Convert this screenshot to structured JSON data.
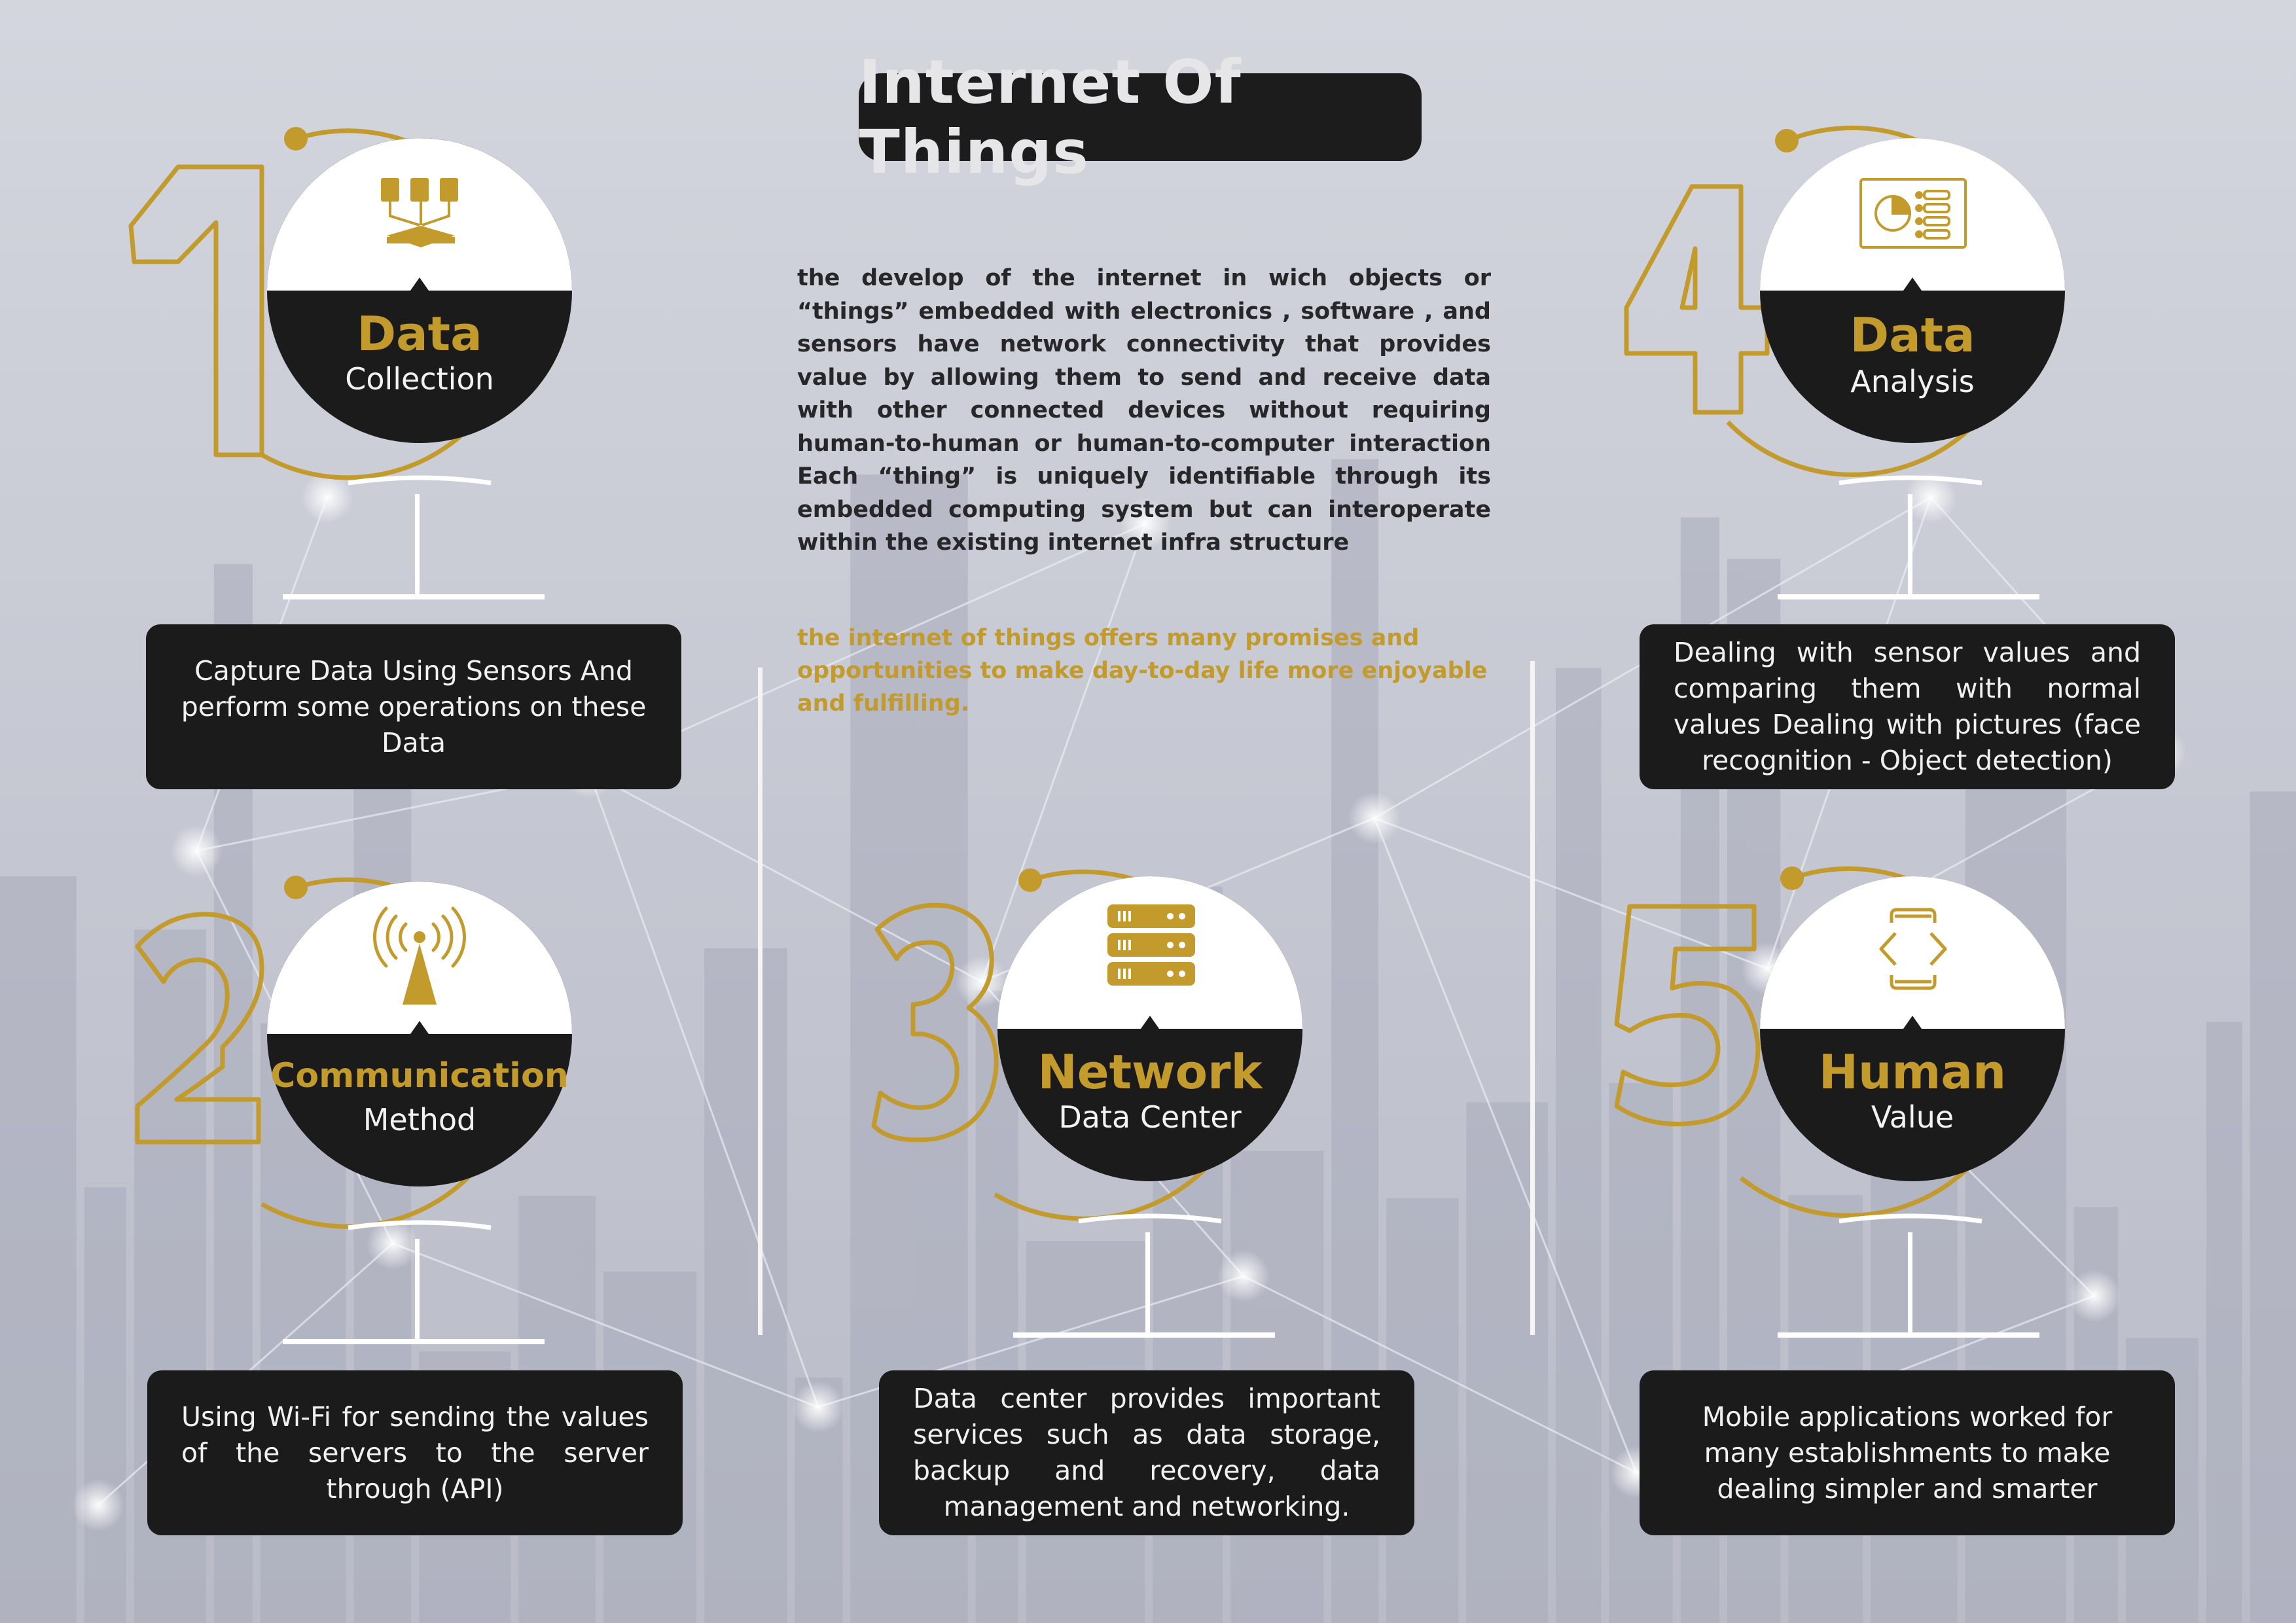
{
  "title": "Internet Of Things",
  "intro": "the develop of the internet in  wich  objects or “things” embedded with electronics  , software , and sensors have network connectivity that provides value by allowing them to send and receive data with other connected devices without requiring human-to-human or human-to-computer interaction Each “thing” is uniquely identifiable through its embedded computing system but can interoperate within the existing internet infra structure",
  "promise": "the  internet of things offers many promises and opportunities to make day-to-day life more enjoyable and fulfilling.",
  "colors": {
    "gold": "#c39a2c",
    "dark": "#1b1b1b",
    "white": "#ffffff"
  },
  "steps": [
    {
      "number": "1",
      "title": "Data",
      "subtitle": "Collection",
      "icon": "data-collection-icon",
      "description": "Capture Data Using Sensors And perform some operations on these Data"
    },
    {
      "number": "2",
      "title": "Communication",
      "subtitle": "Method",
      "icon": "antenna-signal-icon",
      "description": "Using Wi-Fi for sending the values of the servers to the server through (API)"
    },
    {
      "number": "3",
      "title": "Network",
      "subtitle": "Data Center",
      "icon": "server-rack-icon",
      "description": "Data center provides important services such as data storage, backup and recovery, data management and networking."
    },
    {
      "number": "4",
      "title": "Data",
      "subtitle": "Analysis",
      "icon": "analysis-dashboard-icon",
      "description": "Dealing with sensor values and comparing them with normal values Dealing with pictures (face recognition - Object detection)"
    },
    {
      "number": "5",
      "title": "Human",
      "subtitle": "Value",
      "icon": "mobile-code-icon",
      "description": "Mobile applications worked for many establishments to make dealing simpler and smarter"
    }
  ]
}
